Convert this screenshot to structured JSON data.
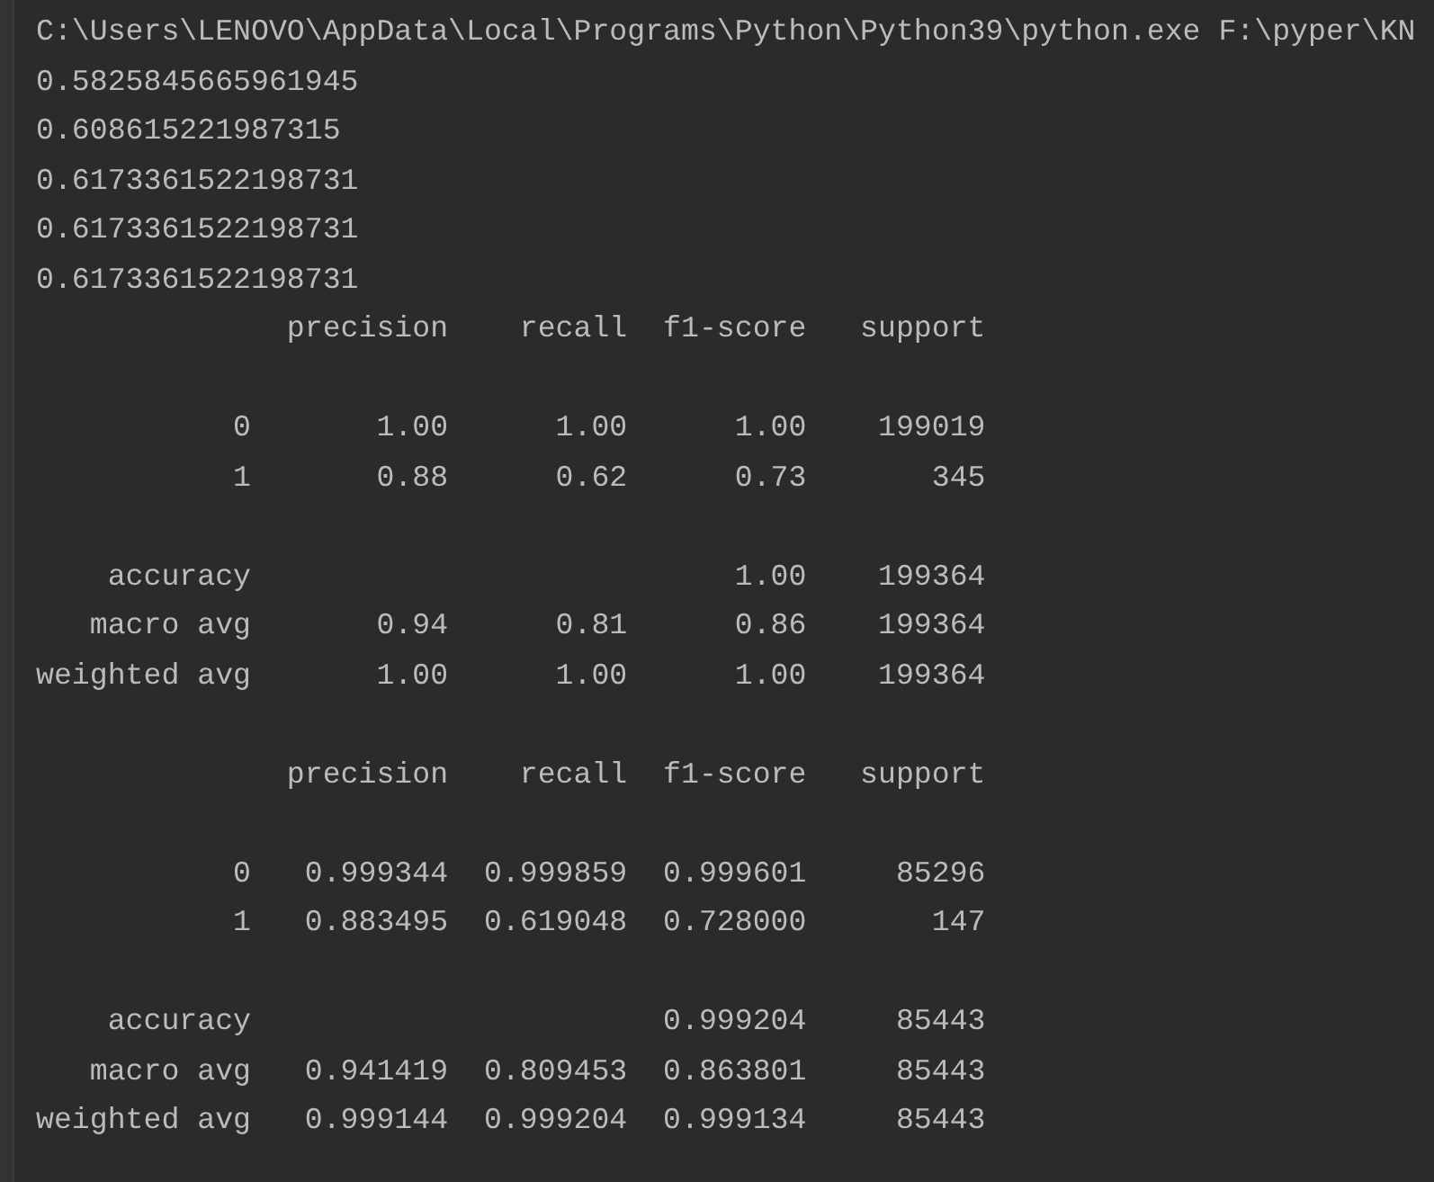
{
  "console": {
    "blocks": [
      [
        "C:\\Users\\LENOVO\\AppData\\Local\\Programs\\Python\\Python39\\python.exe F:\\pyper\\KN",
        "0.5825845665961945",
        "0.608615221987315",
        "0.6173361522198731",
        "0.6173361522198731",
        "0.6173361522198731",
        "              precision    recall  f1-score   support"
      ],
      [
        "           0       1.00      1.00      1.00    199019",
        "           1       0.88      0.62      0.73       345"
      ],
      [
        "    accuracy                           1.00    199364",
        "   macro avg       0.94      0.81      0.86    199364",
        "weighted avg       1.00      1.00      1.00    199364"
      ],
      [
        "              precision    recall  f1-score   support"
      ],
      [
        "           0   0.999344  0.999859  0.999601     85296",
        "           1   0.883495  0.619048  0.728000       147"
      ],
      [
        "    accuracy                       0.999204     85443",
        "   macro avg   0.941419  0.809453  0.863801     85443",
        "weighted avg   0.999144  0.999204  0.999134     85443"
      ]
    ]
  }
}
